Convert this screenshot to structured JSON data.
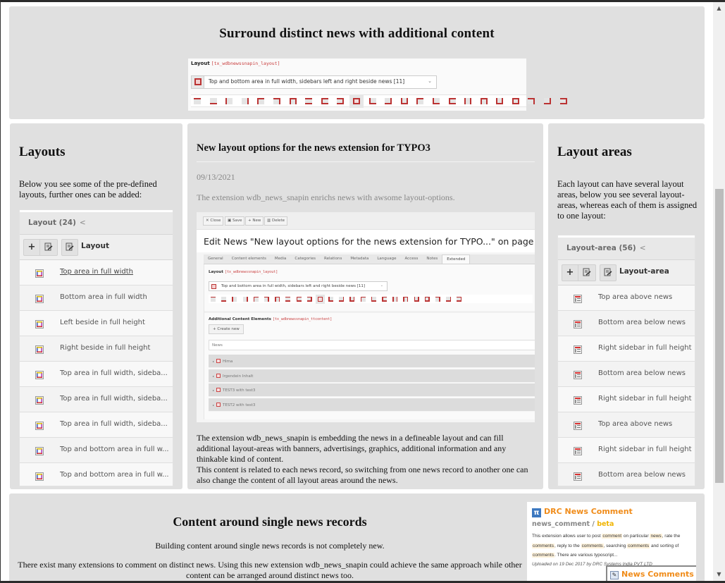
{
  "top_section": {
    "title": "Surround distinct news with additional content",
    "layout_field": {
      "label": "Layout",
      "code": "[tx_wdbnewssnapin_layout]",
      "selected_value": "Top and bottom area in full width, sidebars left and right beside news [11]",
      "selected_index": 10,
      "option_count": 24
    }
  },
  "left_section": {
    "title": "Layouts",
    "intro": "Below you see some of the pre-defined layouts, further ones can be added:",
    "list": {
      "header": "Layout (24)",
      "collapse_glyph": "<",
      "toolbar": {
        "add_glyph": "+",
        "column_title": "Layout"
      },
      "rows": [
        {
          "label": "Top area in full width",
          "linked": true
        },
        {
          "label": "Bottom area in full width",
          "linked": false
        },
        {
          "label": "Left beside in full height",
          "linked": false
        },
        {
          "label": "Right beside in full height",
          "linked": false
        },
        {
          "label": "Top area in full width, sideba...",
          "linked": false
        },
        {
          "label": "Top area in full width, sideba...",
          "linked": false
        },
        {
          "label": "Top area in full width, sideba...",
          "linked": false
        },
        {
          "label": "Top and bottom area in full w...",
          "linked": false
        },
        {
          "label": "Top and bottom area in full w...",
          "linked": false
        }
      ]
    }
  },
  "middle_section": {
    "title": "New layout options for the news extension for TYPO3",
    "date": "09/13/2021",
    "teaser": "The extension wdb_news_snapin enrichs news with awsome layout-options.",
    "backend": {
      "buttons": [
        {
          "icon": "close-icon",
          "glyph": "✕",
          "label": "Close"
        },
        {
          "icon": "save-icon",
          "glyph": "▣",
          "label": "Save"
        },
        {
          "icon": "plus-icon",
          "glyph": "+",
          "label": "New"
        },
        {
          "icon": "trash-icon",
          "glyph": "▥",
          "label": "Delete"
        }
      ],
      "heading": "Edit News \"New layout options for the news extension for TYPO...\" on page \"News Data\"",
      "tabs": [
        "General",
        "Content elements",
        "Media",
        "Categories",
        "Relations",
        "Metadata",
        "Language",
        "Access",
        "Notes",
        "Extended"
      ],
      "active_tab": "Extended",
      "layout_label": "Layout",
      "layout_code": "[tx_wdbnewssnapin_layout]",
      "layout_value": "Top and bottom area in full width, sidebars left and right beside news [11]",
      "ace_label": "Additional Content Elements",
      "ace_code": "[tx_wdbnewssnapin_ttcontent]",
      "create_new": "+ Create new",
      "news_field": "News",
      "records": [
        "Hima",
        "Irgendein Inhalt",
        "TEST3 with test3",
        "TEST2 with test3"
      ]
    },
    "body_1": "The extension wdb_news_snapin is embedding the news in a defineable layout and can fill additional layout-areas with banners, advertisings, graphics, additional information and any thinkable kind of content.",
    "body_2": "This content is related to each news record, so switching from one news record to another one can also change the content of all layout areas around the news."
  },
  "right_section": {
    "title": "Layout areas",
    "intro": "Each layout can have several layout areas, below you see several layout-areas, whereas each of them is assigned to one layout:",
    "list": {
      "header": "Layout-area (56)",
      "collapse_glyph": "<",
      "toolbar": {
        "add_glyph": "+",
        "column_title": "Layout-area"
      },
      "rows": [
        {
          "label": "Top area above news"
        },
        {
          "label": "Bottom area below news"
        },
        {
          "label": "Right sidebar in full height"
        },
        {
          "label": "Bottom area below news"
        },
        {
          "label": "Right sidebar in full height"
        },
        {
          "label": "Top area above news"
        },
        {
          "label": "Right sidebar in full height"
        },
        {
          "label": "Bottom area below news"
        }
      ]
    }
  },
  "bottom_section": {
    "title": "Content around single news records",
    "p1": "Building content around single news records is not completely new.",
    "p2": "There exist many extensions to comment on distinct news. Using this new extension wdb_news_snapin could achieve the same approach while other content can be arranged around distinct news too.",
    "card": {
      "logo_glyph": "π",
      "title": "DRC News Comment",
      "extension_key": "news_comment",
      "separator": " / ",
      "state": "beta",
      "desc_parts": [
        {
          "t": "This extension allows user to post ",
          "m": false
        },
        {
          "t": "comment",
          "m": true
        },
        {
          "t": " on particular ",
          "m": false
        },
        {
          "t": "news",
          "m": true
        },
        {
          "t": ", rate the ",
          "m": false
        },
        {
          "t": "comments",
          "m": true
        },
        {
          "t": ", reply to the ",
          "m": false
        },
        {
          "t": "comments",
          "m": true
        },
        {
          "t": ", searching ",
          "m": false
        },
        {
          "t": "comments",
          "m": true
        },
        {
          "t": " and sorting of ",
          "m": false
        },
        {
          "t": "comments",
          "m": true
        },
        {
          "t": ". There are various typoscript...",
          "m": false
        }
      ],
      "uploaded": "Uploaded on 19 Dec 2017 by DRC Systems India PVT LTD",
      "overlay_title": "News Comments"
    }
  },
  "scrollbar": {
    "up_glyph": "▲",
    "down_glyph": "▼",
    "position_fraction": 0.32
  },
  "colors": {
    "panel": "#e0e0e0",
    "accent_red": "#bb3333",
    "drc_orange": "#f08c1a",
    "beta_yellow": "#f0b400"
  }
}
